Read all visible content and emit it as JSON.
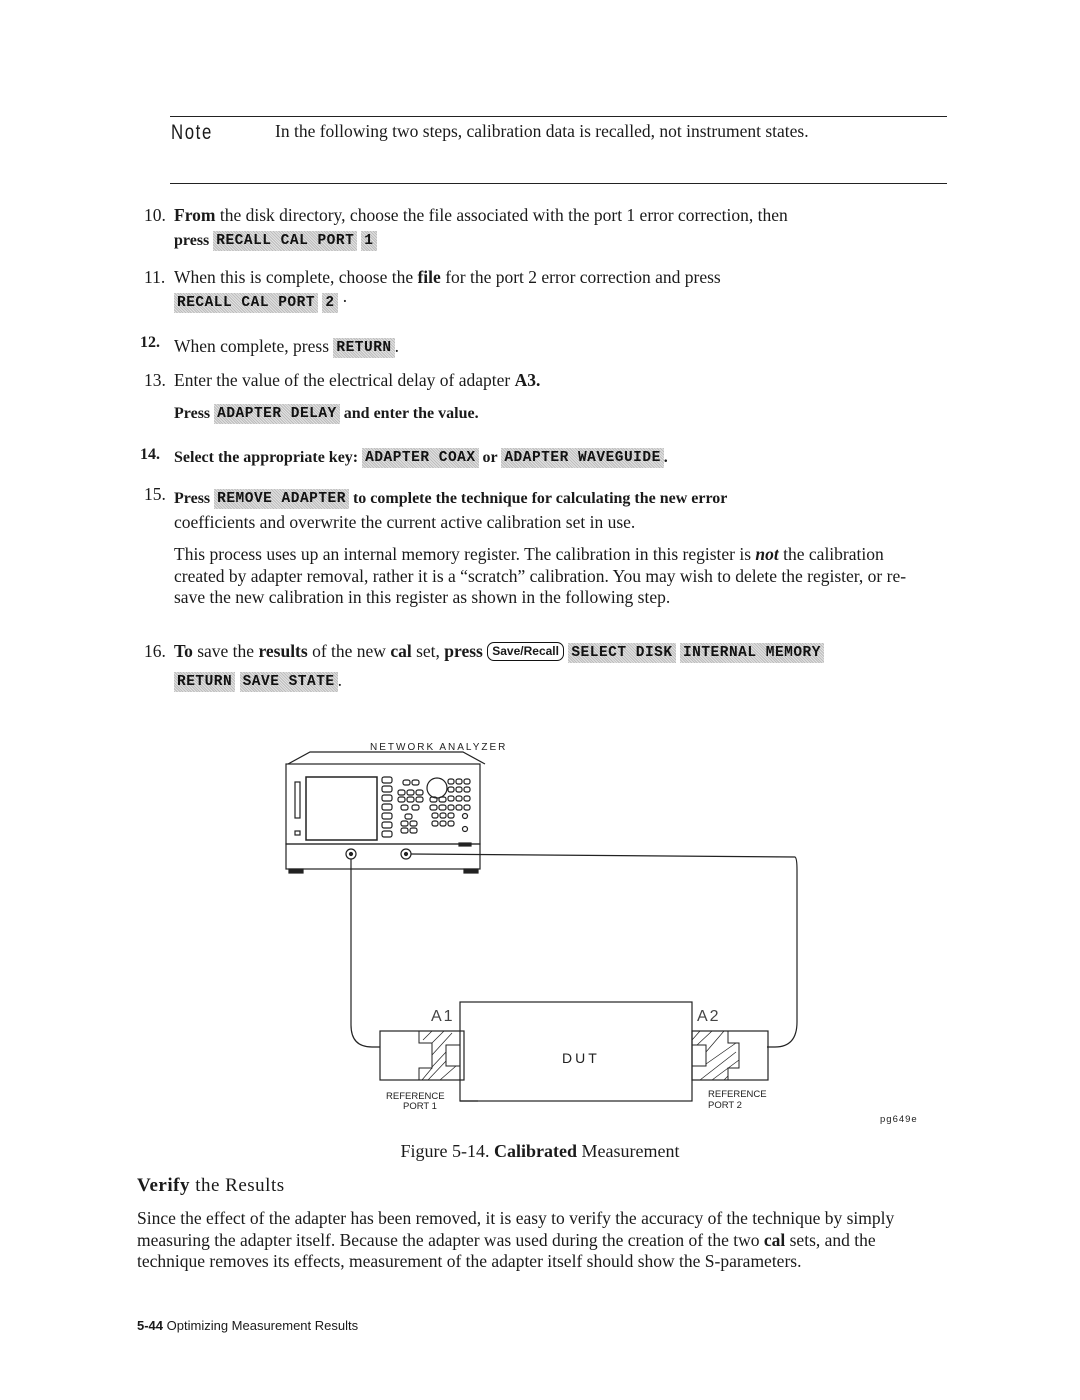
{
  "note": {
    "label": "Note",
    "text": "In the following two steps, calibration data is recalled, not instrument states."
  },
  "steps": {
    "s10": {
      "num": "10.",
      "lead_bold": "From",
      "text": " the disk directory, choose the file associated with the port 1 error correction, then",
      "line2_pre": "press ",
      "keys": [
        "RECALL CAL PORT",
        "1"
      ]
    },
    "s11": {
      "num": "11.",
      "text_a": "When this is complete, choose the ",
      "bold": "file",
      "text_b": " for the port 2 error correction and press",
      "keys": [
        "RECALL CAL PORT",
        "2"
      ],
      "end": " ·"
    },
    "s12": {
      "num": "12.",
      "text": "When complete, press ",
      "key": "RETURN",
      "end": "."
    },
    "s13": {
      "num": "13.",
      "text": "Enter the value of the electrical delay of adapter ",
      "bold": "A3.",
      "line2_pre": "Press ",
      "key": "ADAPTER DELAY",
      "line2_post": " and enter the value."
    },
    "s14": {
      "num": "14.",
      "text": "Select the appropriate key: ",
      "key1": "ADAPTER COAX",
      "mid": " or ",
      "key2": "ADAPTER WAVEGUIDE",
      "end": "."
    },
    "s15": {
      "num": "15.",
      "pre": "Press ",
      "key": "REMOVE ADAPTER",
      "post": " to complete the technique for calculating the new error",
      "line2": "coefficients and overwrite the current active calibration set in use.",
      "para_a": "This process uses up an internal memory register. The calibration in this register is ",
      "para_em": "not",
      "para_b": " the calibration created by adapter removal, rather it is a “scratch” calibration. You may wish to delete the register, or re-save the new calibration in this register as shown in the following  step."
    },
    "s16": {
      "num": "16.",
      "b1": "To",
      "t1": " save the ",
      "b2": "results",
      "t2": " of the new ",
      "b3": "cal",
      "t3": " set, ",
      "b4": "press ",
      "hardkey": "Save/Recall",
      "keys_line1": [
        "SELECT DISK",
        "INTERNAL MEMORY"
      ],
      "keys_line2": [
        "RETURN",
        "SAVE STATE"
      ],
      "end": "."
    }
  },
  "figure": {
    "instrument_label": "NETWORK ANALYZER",
    "adapter1_label": "A1",
    "adapter2_label": "A2",
    "dut_label": "DUT",
    "ref1_line1": "REFERENCE",
    "ref1_line2": "PORT 1",
    "ref2_line1": "REFERENCE",
    "ref2_line2": "PORT 2",
    "figure_id": "pg649e",
    "caption_pre": "Figure 5-14. ",
    "caption_bold": "Calibrated",
    "caption_post": " Measurement"
  },
  "section": {
    "title_bold": "Verify",
    "title_rest": " the Results",
    "body_a": "Since the effect of the adapter has been removed, it is easy to verify the accuracy of the technique by simply measuring the adapter itself. Because the adapter was used during the creation of the two ",
    "body_bold": "cal",
    "body_b": " sets, and the technique removes its effects, measurement of the adapter itself should show the S-parameters."
  },
  "footer": {
    "page": "5-44",
    "title": " Optimizing Measurement Results"
  }
}
